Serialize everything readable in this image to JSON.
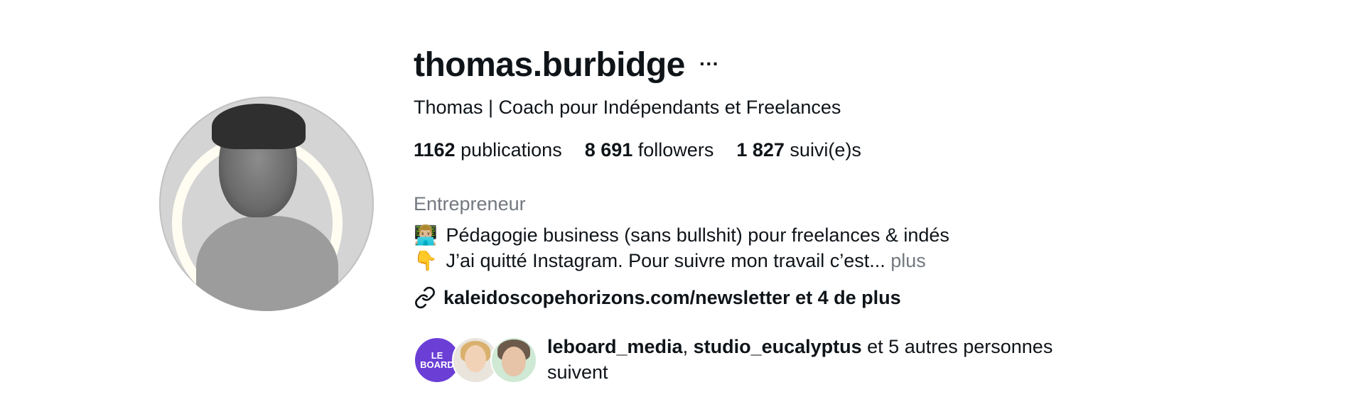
{
  "profile": {
    "username": "thomas.burbidge",
    "more_icon": "···",
    "full_name": "Thomas | Coach pour Indépendants et Freelances",
    "stats": {
      "posts_count": "1162",
      "posts_label": "publications",
      "followers_count": "8 691",
      "followers_label": "followers",
      "following_count": "1 827",
      "following_label": "suivi(e)s"
    },
    "category": "Entrepreneur",
    "bio": {
      "line1_emoji": "👨🏼‍💻",
      "line1_text": "Pédagogie business (sans bullshit) pour freelances & indés",
      "line2_emoji": "👇",
      "line2_text": "J’ai quitté Instagram. Pour suivre mon travail c’est...",
      "more_label": "plus"
    },
    "link": {
      "icon": "link-icon",
      "text": "kaleidoscopehorizons.com/newsletter et 4 de plus"
    },
    "followed_by": {
      "avatar1_label": "LE BOARD",
      "user1": "leboard_media",
      "separator": ", ",
      "user2": "studio_eucalyptus",
      "rest": " et 5 autres personnes suivent"
    }
  }
}
